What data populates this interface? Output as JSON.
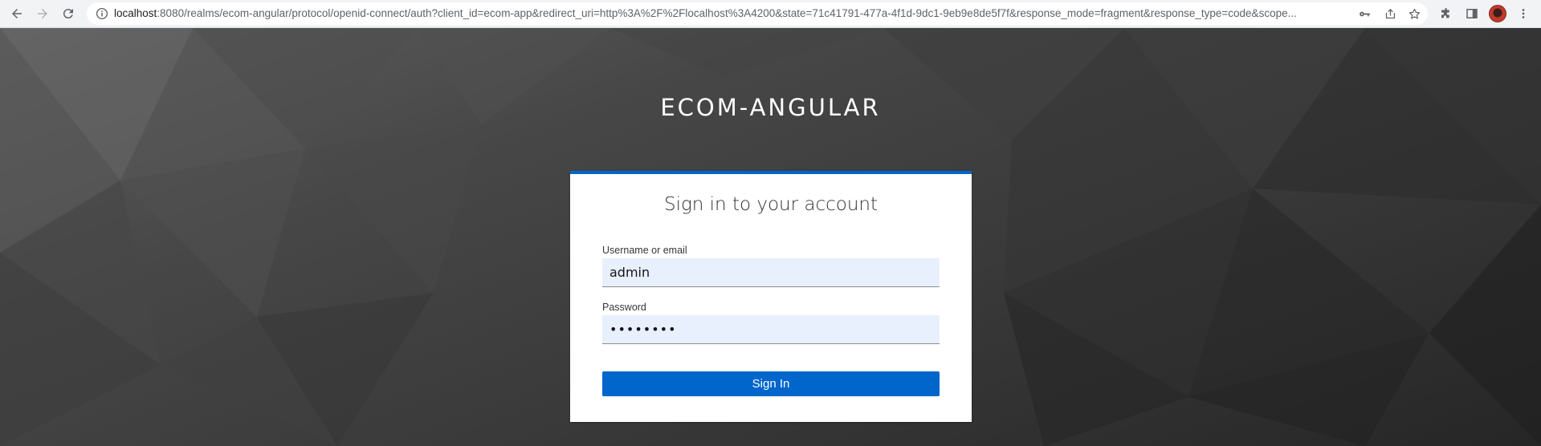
{
  "browser": {
    "url_host": "localhost",
    "url_rest": ":8080/realms/ecom-angular/protocol/openid-connect/auth?client_id=ecom-app&redirect_uri=http%3A%2F%2Flocalhost%3A4200&state=71c41791-477a-4f1d-9dc1-9eb9e8de5f7f&response_mode=fragment&response_type=code&scope...",
    "icons": [
      "back-arrow-icon",
      "forward-arrow-icon",
      "reload-icon",
      "info-icon",
      "key-icon",
      "share-icon",
      "star-icon",
      "extensions-icon",
      "side-panel-icon",
      "profile-avatar",
      "menu-icon"
    ]
  },
  "realm": {
    "title": "ECOM-ANGULAR"
  },
  "login": {
    "title": "Sign in to your account",
    "username_label": "Username or email",
    "username_value": "admin",
    "password_label": "Password",
    "password_value": "••••••••",
    "submit_label": "Sign In"
  },
  "colors": {
    "accent": "#0066cc",
    "input_autofill": "#e8f0fe",
    "background": "#3a3a3a"
  }
}
